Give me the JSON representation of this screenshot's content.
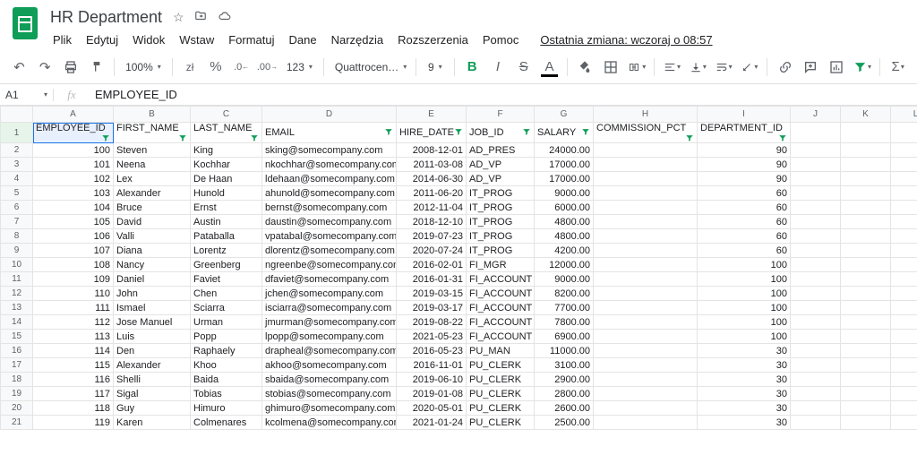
{
  "header": {
    "doc_title": "HR Department",
    "icons": [
      "star-outline-icon",
      "move-to-folder-icon",
      "cloud-saved-icon"
    ],
    "menus": [
      "Plik",
      "Edytuj",
      "Widok",
      "Wstaw",
      "Formatuj",
      "Dane",
      "Narzędzia",
      "Rozszerzenia",
      "Pomoc"
    ],
    "last_edit": "Ostatnia zmiana: wczoraj o 08:57"
  },
  "toolbar": {
    "zoom": "100%",
    "currency": "zł",
    "percent": "%",
    "dec_dec": ".0",
    "dec_inc": ".00",
    "more_fmt": "123",
    "font": "Quattrocen…",
    "size": "9"
  },
  "formula_bar": {
    "name_box": "A1",
    "fx": "fx",
    "value": "EMPLOYEE_ID"
  },
  "columns": [
    "A",
    "B",
    "C",
    "D",
    "E",
    "F",
    "G",
    "H",
    "I",
    "J",
    "K",
    "L"
  ],
  "data_headers": [
    "EMPLOYEE_ID",
    "FIRST_NAME",
    "LAST_NAME",
    "EMAIL",
    "HIRE_DATE",
    "JOB_ID",
    "SALARY",
    "COMMISSION_PCT",
    "DEPARTMENT_ID"
  ],
  "rows": [
    {
      "n": 2,
      "id": "100",
      "fn": "Steven",
      "ln": "King",
      "em": "sking@somecompany.com",
      "hd": "2008-12-01",
      "job": "AD_PRES",
      "sal": "24000.00",
      "com": "",
      "dep": "90"
    },
    {
      "n": 3,
      "id": "101",
      "fn": "Neena",
      "ln": "Kochhar",
      "em": "nkochhar@somecompany.com",
      "hd": "2011-03-08",
      "job": "AD_VP",
      "sal": "17000.00",
      "com": "",
      "dep": "90"
    },
    {
      "n": 4,
      "id": "102",
      "fn": "Lex",
      "ln": "De Haan",
      "em": "ldehaan@somecompany.com",
      "hd": "2014-06-30",
      "job": "AD_VP",
      "sal": "17000.00",
      "com": "",
      "dep": "90"
    },
    {
      "n": 5,
      "id": "103",
      "fn": "Alexander",
      "ln": "Hunold",
      "em": "ahunold@somecompany.com",
      "hd": "2011-06-20",
      "job": "IT_PROG",
      "sal": "9000.00",
      "com": "",
      "dep": "60"
    },
    {
      "n": 6,
      "id": "104",
      "fn": "Bruce",
      "ln": "Ernst",
      "em": "bernst@somecompany.com",
      "hd": "2012-11-04",
      "job": "IT_PROG",
      "sal": "6000.00",
      "com": "",
      "dep": "60"
    },
    {
      "n": 7,
      "id": "105",
      "fn": "David",
      "ln": "Austin",
      "em": "daustin@somecompany.com",
      "hd": "2018-12-10",
      "job": "IT_PROG",
      "sal": "4800.00",
      "com": "",
      "dep": "60"
    },
    {
      "n": 8,
      "id": "106",
      "fn": "Valli",
      "ln": "Pataballa",
      "em": "vpatabal@somecompany.com",
      "hd": "2019-07-23",
      "job": "IT_PROG",
      "sal": "4800.00",
      "com": "",
      "dep": "60"
    },
    {
      "n": 9,
      "id": "107",
      "fn": "Diana",
      "ln": "Lorentz",
      "em": "dlorentz@somecompany.com",
      "hd": "2020-07-24",
      "job": "IT_PROG",
      "sal": "4200.00",
      "com": "",
      "dep": "60"
    },
    {
      "n": 10,
      "id": "108",
      "fn": "Nancy",
      "ln": "Greenberg",
      "em": "ngreenbe@somecompany.com",
      "hd": "2016-02-01",
      "job": "FI_MGR",
      "sal": "12000.00",
      "com": "",
      "dep": "100"
    },
    {
      "n": 11,
      "id": "109",
      "fn": "Daniel",
      "ln": "Faviet",
      "em": "dfaviet@somecompany.com",
      "hd": "2016-01-31",
      "job": "FI_ACCOUNT",
      "sal": "9000.00",
      "com": "",
      "dep": "100"
    },
    {
      "n": 12,
      "id": "110",
      "fn": "John",
      "ln": "Chen",
      "em": "jchen@somecompany.com",
      "hd": "2019-03-15",
      "job": "FI_ACCOUNT",
      "sal": "8200.00",
      "com": "",
      "dep": "100"
    },
    {
      "n": 13,
      "id": "111",
      "fn": "Ismael",
      "ln": "Sciarra",
      "em": "isciarra@somecompany.com",
      "hd": "2019-03-17",
      "job": "FI_ACCOUNT",
      "sal": "7700.00",
      "com": "",
      "dep": "100"
    },
    {
      "n": 14,
      "id": "112",
      "fn": "Jose Manuel",
      "ln": "Urman",
      "em": "jmurman@somecompany.com",
      "hd": "2019-08-22",
      "job": "FI_ACCOUNT",
      "sal": "7800.00",
      "com": "",
      "dep": "100"
    },
    {
      "n": 15,
      "id": "113",
      "fn": "Luis",
      "ln": "Popp",
      "em": "lpopp@somecompany.com",
      "hd": "2021-05-23",
      "job": "FI_ACCOUNT",
      "sal": "6900.00",
      "com": "",
      "dep": "100"
    },
    {
      "n": 16,
      "id": "114",
      "fn": "Den",
      "ln": "Raphaely",
      "em": "drapheal@somecompany.com",
      "hd": "2016-05-23",
      "job": "PU_MAN",
      "sal": "11000.00",
      "com": "",
      "dep": "30"
    },
    {
      "n": 17,
      "id": "115",
      "fn": "Alexander",
      "ln": "Khoo",
      "em": "akhoo@somecompany.com",
      "hd": "2016-11-01",
      "job": "PU_CLERK",
      "sal": "3100.00",
      "com": "",
      "dep": "30"
    },
    {
      "n": 18,
      "id": "116",
      "fn": "Shelli",
      "ln": "Baida",
      "em": "sbaida@somecompany.com",
      "hd": "2019-06-10",
      "job": "PU_CLERK",
      "sal": "2900.00",
      "com": "",
      "dep": "30"
    },
    {
      "n": 19,
      "id": "117",
      "fn": "Sigal",
      "ln": "Tobias",
      "em": "stobias@somecompany.com",
      "hd": "2019-01-08",
      "job": "PU_CLERK",
      "sal": "2800.00",
      "com": "",
      "dep": "30"
    },
    {
      "n": 20,
      "id": "118",
      "fn": "Guy",
      "ln": "Himuro",
      "em": "ghimuro@somecompany.com",
      "hd": "2020-05-01",
      "job": "PU_CLERK",
      "sal": "2600.00",
      "com": "",
      "dep": "30"
    },
    {
      "n": 21,
      "id": "119",
      "fn": "Karen",
      "ln": "Colmenares",
      "em": "kcolmena@somecompany.com",
      "hd": "2021-01-24",
      "job": "PU_CLERK",
      "sal": "2500.00",
      "com": "",
      "dep": "30"
    }
  ]
}
